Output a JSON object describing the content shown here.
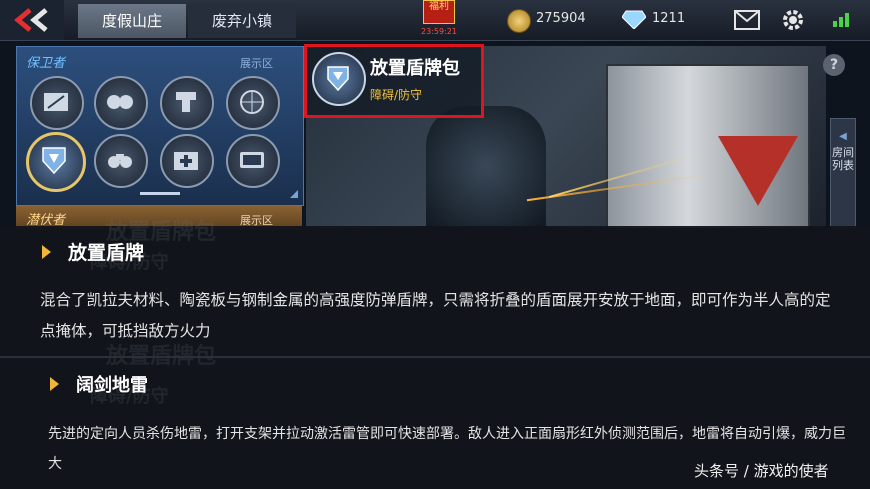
{
  "header": {
    "tabs": [
      {
        "label": "度假山庄",
        "active": true
      },
      {
        "label": "废弃小镇",
        "active": false
      }
    ],
    "welfare": {
      "label": "福利",
      "timer": "23:59:21"
    },
    "coins": "275904",
    "diamonds": "1211"
  },
  "left_panel": {
    "guardian_title": "保卫者",
    "display_label": "展示区",
    "icons": [
      "wall-shield-icon",
      "goggles-icon",
      "turret-icon",
      "radar-lock-icon",
      "shield-pack-icon",
      "binoculars-icon",
      "medkit-icon",
      "gps-device-icon"
    ],
    "selected_index": 4,
    "lurker_title": "潜伏者",
    "lurker_display_label": "展示区"
  },
  "preview": {
    "item_name": "放置盾牌包",
    "item_category": "障碍/防守",
    "help": "?",
    "room_list_tab": "房间列表"
  },
  "description": {
    "items": [
      {
        "title": "放置盾牌",
        "ghost_title": "放置盾牌包",
        "ghost_cat": "障碍/防守",
        "text": "混合了凯拉夫材料、陶瓷板与钢制金属的高强度防弹盾牌，只需将折叠的盾面展开安放于地面，即可作为半人高的定点掩体，可抵挡敌方火力"
      },
      {
        "title": "阔剑地雷",
        "ghost_title": "放置盾牌包",
        "ghost_cat": "障碍/防守",
        "text": "先进的定向人员杀伤地雷，打开支架并拉动激活雷管即可快速部署。敌人进入正面扇形红外侦测范围后，地雷将自动引爆，威力巨大"
      }
    ]
  },
  "watermark": "头条号 / 游戏的使者",
  "colors": {
    "highlight": "#e0141e",
    "accent_gold": "#f2b53a",
    "panel_blue": "#2d4f7d"
  }
}
